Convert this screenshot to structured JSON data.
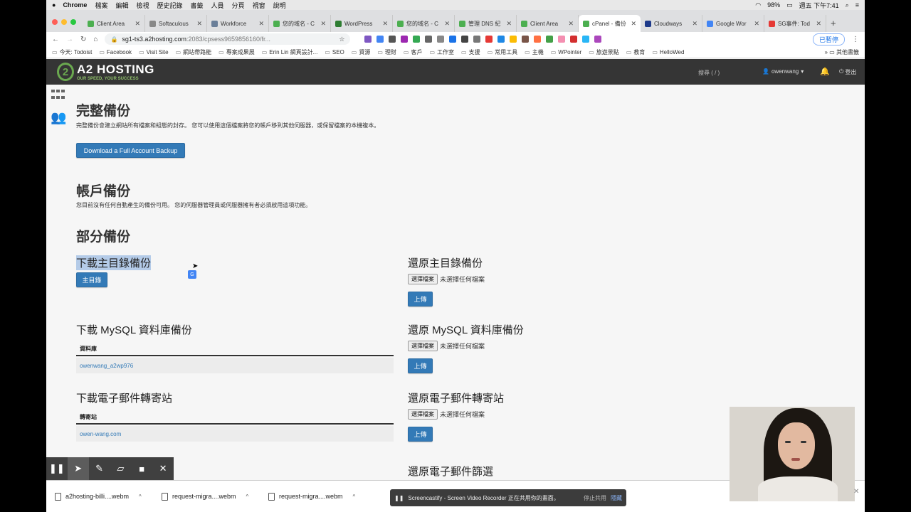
{
  "menubar": {
    "app": "Chrome",
    "items": [
      "檔案",
      "編輯",
      "檢視",
      "歷史記錄",
      "書籤",
      "人員",
      "分頁",
      "視窗",
      "說明"
    ],
    "battery": "98%",
    "clock": "週五 下午7:41"
  },
  "tabs": [
    {
      "title": "Client Area",
      "color": "#4caf50"
    },
    {
      "title": "Softaculous",
      "color": "#888888"
    },
    {
      "title": "Workforce",
      "color": "#6a7f99"
    },
    {
      "title": "您的域名 - C",
      "color": "#4caf50"
    },
    {
      "title": "WordPress",
      "color": "#2e7d32"
    },
    {
      "title": "您的域名 - C",
      "color": "#4caf50"
    },
    {
      "title": "管理 DNS 紀",
      "color": "#4caf50"
    },
    {
      "title": "Client Area",
      "color": "#4caf50"
    },
    {
      "title": "cPanel - 備份",
      "color": "#4caf50",
      "active": true
    },
    {
      "title": "Cloudways",
      "color": "#1e3a8a"
    },
    {
      "title": "Google Wor",
      "color": "#4285f4"
    },
    {
      "title": "SG事件: Tod",
      "color": "#e53935"
    }
  ],
  "address": {
    "host": "sg1-ts3.a2hosting.com",
    "rest": ":2083/cpsess9659856160/fr...",
    "paused_label": "已暫停"
  },
  "bookmarks": [
    "今天: Todoist",
    "Facebook",
    "Visit Site",
    "網站帶路能",
    "專案成果展",
    "Erin Lin 網頁設計...",
    "SEO",
    "資源",
    "理財",
    "客戶",
    "工作室",
    "支援",
    "常用工具",
    "主機",
    "WPointer",
    "旅遊景點",
    "教育",
    "HelloWed"
  ],
  "bookmarks_more": "其他書籤",
  "cpanel": {
    "brand": "A2 HOSTING",
    "tagline": "OUR SPEED, YOUR SUCCESS",
    "search": "搜尋 ( / )",
    "user": "owenwang",
    "logout": "登出"
  },
  "full_backup": {
    "title": "完整備份",
    "desc": "完整備份會建立網站所有檔案和組態的封存。 您可以使用這個檔案將您的帳戶移到其他伺服器，或保留檔案的本機複本。",
    "button": "Download a Full Account Backup"
  },
  "account_backup": {
    "title": "帳戶備份",
    "desc": "您目前沒有任何自動產生的備份可用。 您的伺服器管理員或伺服器擁有者必須啟用這項功能。"
  },
  "partial_backup": {
    "title": "部分備份",
    "home_download_title": "下載主目錄備份",
    "home_button": "主目錄",
    "home_restore_title": "還原主目錄備份",
    "mysql_download_title": "下載 MySQL 資料庫備份",
    "mysql_col": "資料庫",
    "mysql_db": "owenwang_a2wp976",
    "mysql_restore_title": "還原 MySQL 資料庫備份",
    "fwd_download_title": "下載電子郵件轉寄站",
    "fwd_col": "轉寄站",
    "fwd_domain": "owen-wang.com",
    "fwd_restore_title": "還原電子郵件轉寄站",
    "filter_restore_title": "還原電子郵件篩選",
    "choose_file": "選擇檔案",
    "no_file": "未選擇任何檔案",
    "upload": "上傳"
  },
  "downloads": [
    {
      "name": "a2hosting-billi....webm"
    },
    {
      "name": "request-migra....webm"
    },
    {
      "name": "request-migra....webm"
    }
  ],
  "share_notice": {
    "text": "Screencastify - Screen Video Recorder 正在共用你的畫面。",
    "stop": "停止共用",
    "hide": "隱藏"
  }
}
